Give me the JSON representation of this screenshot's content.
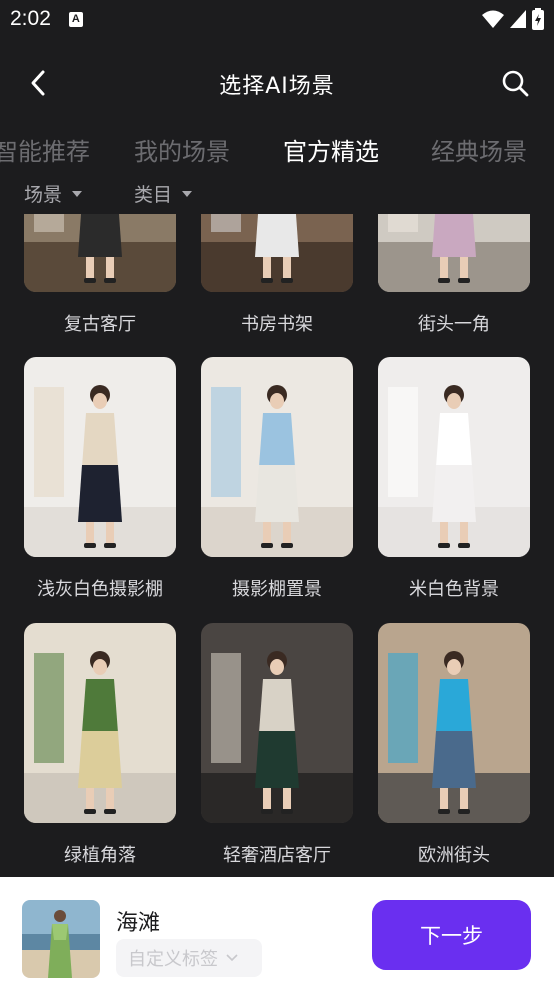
{
  "status_bar": {
    "time": "2:02",
    "notification_icon": "A"
  },
  "nav": {
    "title": "选择AI场景",
    "back_icon": "back-arrow-icon",
    "search_icon": "search-icon"
  },
  "tabs": [
    {
      "label": "智能推荐",
      "active": false
    },
    {
      "label": "我的场景",
      "active": false
    },
    {
      "label": "官方精选",
      "active": true
    },
    {
      "label": "经典场景",
      "active": false
    }
  ],
  "filters": [
    {
      "label": "场景"
    },
    {
      "label": "类目"
    }
  ],
  "scenes": [
    {
      "label": "复古客厅",
      "bg": "#8a7a66",
      "floor": "#5a4a3a",
      "accent": "#d9d0c2",
      "clothes": "#2b2b2b"
    },
    {
      "label": "书房书架",
      "bg": "#7a6350",
      "floor": "#4a3a2e",
      "accent": "#d8d8d8",
      "clothes": "#e8e8e8"
    },
    {
      "label": "街头一角",
      "bg": "#cfcac2",
      "floor": "#9c958c",
      "accent": "#efe8e0",
      "clothes": "#c9a8c0"
    },
    {
      "label": "浅灰白色摄影棚",
      "bg": "#efedea",
      "floor": "#e2ded9",
      "accent": "#e4d7c2",
      "clothes": "#1e2230"
    },
    {
      "label": "摄影棚置景",
      "bg": "#ece8e2",
      "floor": "#dcd5cc",
      "accent": "#9bc3e0",
      "clothes": "#e8e6e0"
    },
    {
      "label": "米白色背景",
      "bg": "#efedec",
      "floor": "#e6e3e1",
      "accent": "#ffffff",
      "clothes": "#f2f0f0"
    },
    {
      "label": "绿植角落",
      "bg": "#e4ddd0",
      "floor": "#cfc8bd",
      "accent": "#4f7a3a",
      "clothes": "#dccd9a"
    },
    {
      "label": "轻奢酒店客厅",
      "bg": "#4a4542",
      "floor": "#2a2827",
      "accent": "#d8d2c6",
      "clothes": "#1f3a30"
    },
    {
      "label": "欧洲街头",
      "bg": "#b9a58e",
      "floor": "#5f5a55",
      "accent": "#2aa8d8",
      "clothes": "#4a6a8c"
    }
  ],
  "selected": {
    "name": "海滩",
    "tag_placeholder": "自定义标签"
  },
  "next_button": {
    "label": "下一步"
  },
  "colors": {
    "background": "#1c1c1e",
    "accent": "#6a2ff0",
    "tab_inactive": "#6c6c70"
  }
}
